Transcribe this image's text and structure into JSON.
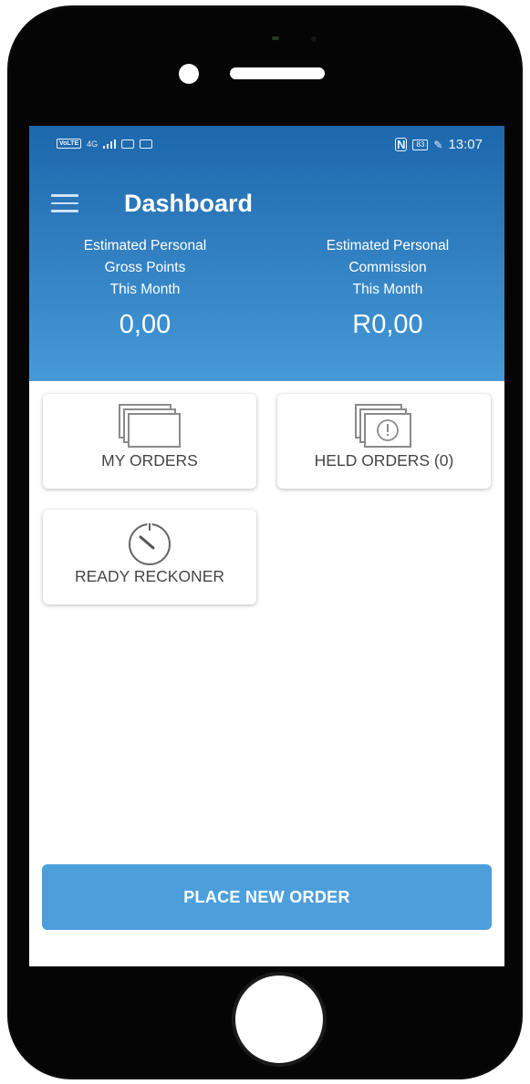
{
  "status_bar": {
    "left_network": "4G",
    "volte": "VoLTE",
    "battery": "83",
    "time": "13:07"
  },
  "header": {
    "title": "Dashboard"
  },
  "stats": {
    "points": {
      "label_line1": "Estimated Personal",
      "label_line2": "Gross Points",
      "label_line3": "This Month",
      "value": "0,00"
    },
    "commission": {
      "label_line1": "Estimated Personal",
      "label_line2": "Commission",
      "label_line3": "This Month",
      "value": "R0,00"
    }
  },
  "tiles": {
    "my_orders": {
      "label": "MY ORDERS",
      "icon": "stacked-cards-icon"
    },
    "held_orders": {
      "label": "HELD ORDERS (0)",
      "icon": "stacked-cards-alert-icon"
    },
    "ready_reckoner": {
      "label": "READY RECKONER",
      "icon": "stopwatch-icon"
    }
  },
  "cta": {
    "label": "PLACE  NEW ORDER"
  },
  "colors": {
    "header_top": "#1d67ac",
    "header_bottom": "#4699d7",
    "cta": "#4d9fdc"
  }
}
